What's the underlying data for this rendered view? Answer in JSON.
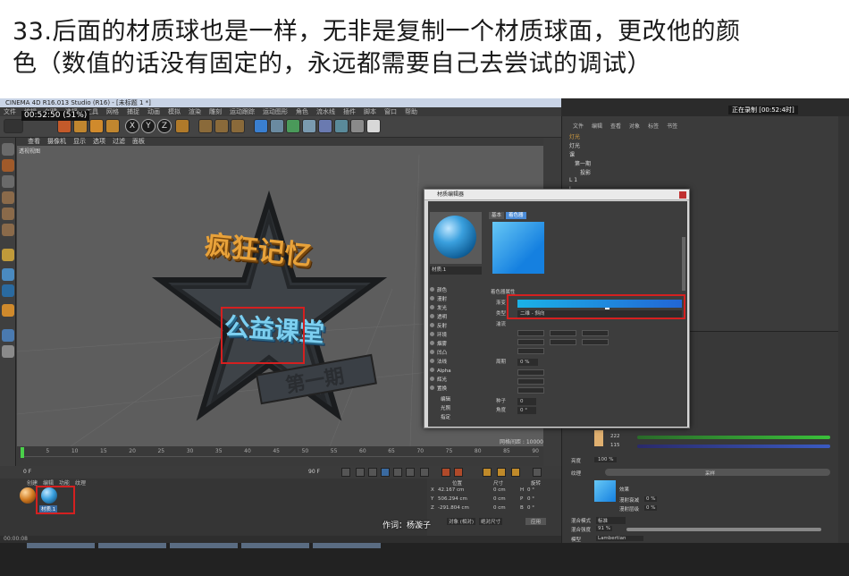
{
  "caption": {
    "line1": "33.后面的材质球也是一样，无非是复制一个材质球面，更改他的颜",
    "line2": "色（数值的话没有固定的，永远都需要自己去尝试的调试）"
  },
  "window": {
    "title": "CINEMA 4D R16.013 Studio (R16) - [未标题 1 *]",
    "recording": "正在录制 [00:52:4时]",
    "timer": "00:52:50 (51%)"
  },
  "menus": {
    "main": [
      "文件",
      "编辑",
      "创建",
      "选择",
      "工具",
      "网格",
      "捕捉",
      "动画",
      "模拟",
      "渲染",
      "雕刻",
      "运动跟踪",
      "运动图形",
      "角色",
      "流水线",
      "插件",
      "脚本",
      "窗口",
      "帮助"
    ],
    "viewport": [
      "查看",
      "摄像机",
      "显示",
      "选项",
      "过滤",
      "面板"
    ],
    "objmgr": [
      "文件",
      "编辑",
      "查看",
      "对象",
      "标签",
      "书签"
    ],
    "matmgr": [
      "创建",
      "编辑",
      "功能",
      "纹理"
    ]
  },
  "toolbar": {
    "axes": [
      "X",
      "Y",
      "Z"
    ]
  },
  "viewport": {
    "label": "透视视图",
    "grid_text": "网格间距 : 10000 cm",
    "logo_line1": "疯狂记忆",
    "logo_line2": "公益课堂",
    "logo_line3": "第一期"
  },
  "timeline": {
    "ticks": [
      "0",
      "5",
      "10",
      "15",
      "20",
      "25",
      "30",
      "35",
      "40",
      "45",
      "50",
      "55",
      "60",
      "65",
      "70",
      "75",
      "80",
      "85",
      "90"
    ],
    "frame_start": "0 F",
    "frame_end": "90 F",
    "frame_cur": "0 F"
  },
  "material_panel": {
    "ball_label": "材质.1"
  },
  "coords": {
    "headers": [
      "位置",
      "尺寸",
      "旋转"
    ],
    "rows": [
      {
        "axis": "X",
        "pos": "42.167 cm",
        "size": "0 cm",
        "rot": "H",
        "rotv": "0 °"
      },
      {
        "axis": "Y",
        "pos": "506.294 cm",
        "size": "0 cm",
        "rot": "P",
        "rotv": "0 °"
      },
      {
        "axis": "Z",
        "pos": "-291.804 cm",
        "size": "0 cm",
        "rot": "B",
        "rotv": "0 °"
      }
    ],
    "mode1": "对象 (相对)",
    "mode2": "绝对尺寸",
    "apply": "应用"
  },
  "lyric": "作词：杨漩子",
  "statusbar": "00:00:08",
  "objmgr": {
    "rows": [
      "灯光",
      "灯光",
      "课",
      "第一期",
      "投影",
      "L 1",
      "L"
    ]
  },
  "attr": {
    "color_values": [
      "222",
      "115"
    ],
    "brightness_label": "亮度",
    "brightness": "100 %",
    "texture_label": "纹理",
    "blend_mode": "混合模式",
    "blend_mode_val": "标准",
    "blend_strength": "混合强度",
    "blend_strength_val": "91 %",
    "model": "模型",
    "model_val": "Lambertian",
    "effect_label": "效果",
    "effect1": "漫射衰减",
    "effect2": "漫射层级",
    "zero": "0 %",
    "sample": "采样"
  },
  "dialog": {
    "title": "材质编辑器",
    "material_name": "材质.1",
    "tabs": [
      "基本",
      "着色器"
    ],
    "props_title": "着色器属性",
    "prop_gradient": "渐变",
    "prop_type": "类型",
    "prop_type_val": "二维 - 斜向",
    "prop_turb": "湍流",
    "prop_cycle": "周期",
    "prop_cycle_val": "0 %",
    "prop_angle": "角度",
    "prop_angle_val": "0 °",
    "prop_seed": "种子",
    "prop_seed_val": "0",
    "channels": [
      "颜色",
      "漫射",
      "发光",
      "透明",
      "反射",
      "环境",
      "烟雾",
      "凹凸",
      "法线",
      "Alpha",
      "辉光",
      "置换",
      "编辑",
      "光照",
      "指定"
    ]
  },
  "colors": {
    "accent": "#4b8cd8",
    "gradient_start": "#1bb2e6",
    "gradient_end": "#2266d6",
    "highlight": "#d42020"
  }
}
